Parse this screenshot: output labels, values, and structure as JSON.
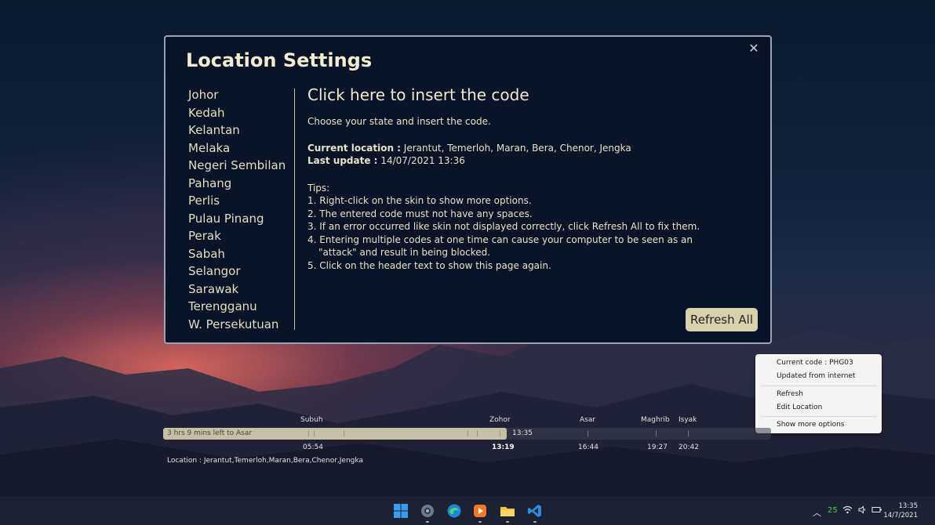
{
  "dialog": {
    "title": "Location Settings",
    "close_label": "✕",
    "states": [
      "Johor",
      "Kedah",
      "Kelantan",
      "Melaka",
      "Negeri Sembilan",
      "Pahang",
      "Perlis",
      "Pulau Pinang",
      "Perak",
      "Sabah",
      "Selangor",
      "Sarawak",
      "Terengganu",
      "W. Persekutuan"
    ],
    "insert_link": "Click here to insert the code",
    "description": "Choose your state and insert the code.",
    "current_location_label": "Current location :",
    "current_location_value": "Jerantut, Temerloh, Maran, Bera, Chenor, Jengka",
    "last_update_label": "Last update :",
    "last_update_value": "14/07/2021 13:36",
    "tips_header": "Tips:",
    "tips": [
      "1. Right-click on the skin to show more options.",
      "2. The entered code must not have any spaces.",
      "3. If an error occurred like skin not displayed correctly, click Refresh All to fix them.",
      "4. Entering multiple codes at one time can cause your computer to be seen as an",
      "\"attack\" and result in being blocked.",
      "5. Click on the header text to show this page again."
    ],
    "refresh_all_label": "Refresh All"
  },
  "context_menu": {
    "current_code": "Current code : PHG03",
    "updated": "Updated from internet",
    "refresh": "Refresh",
    "edit_location": "Edit Location",
    "show_more": "Show more options"
  },
  "prayer_bar": {
    "names": [
      "Subuh",
      "Zohor",
      "Asar",
      "Maghrib",
      "Isyak"
    ],
    "times": [
      "05:54",
      "13:19",
      "16:44",
      "19:27",
      "20:42"
    ],
    "countdown": "3 hrs 9 mins left to Asar",
    "current_time": "13:35",
    "progress_fraction": 0.565,
    "location": "Location : Jerantut,Temerloh,Maran,Bera,Chenor,Jengka"
  },
  "taskbar": {
    "tray_number": "25",
    "clock_time": "13:35",
    "clock_date": "14/7/2021",
    "icons": [
      "windows-start-icon",
      "settings-icon",
      "edge-icon",
      "media-player-icon",
      "file-explorer-icon",
      "vscode-icon"
    ]
  }
}
